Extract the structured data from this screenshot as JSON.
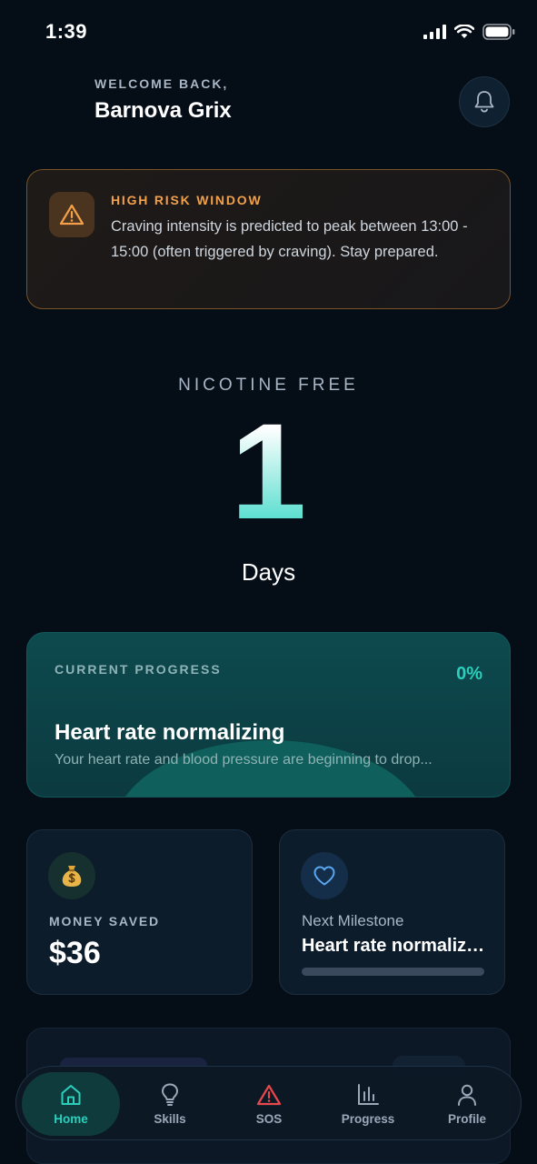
{
  "status_bar": {
    "time": "1:39"
  },
  "header": {
    "welcome": "WELCOME BACK,",
    "username": "Barnova Grix"
  },
  "risk_alert": {
    "title": "HIGH RISK WINDOW",
    "message": "Craving intensity is predicted to peak between 13:00 - 15:00 (often triggered by craving). Stay prepared.",
    "accent_color": "#f3a04a"
  },
  "streak": {
    "label": "NICOTINE FREE",
    "count": "1",
    "unit": "Days"
  },
  "current_progress": {
    "label": "CURRENT PROGRESS",
    "percent": "0%",
    "title": "Heart rate normalizing",
    "description": "Your heart rate and blood pressure are beginning to drop..."
  },
  "money": {
    "icon": "money-bag-icon",
    "label": "MONEY SAVED",
    "value": "$36"
  },
  "milestone": {
    "icon": "heart-icon",
    "label": "Next Milestone",
    "value": "Heart rate normalizing",
    "progress": 0
  },
  "tabs": [
    {
      "label": "Home",
      "icon": "home-icon",
      "active": true
    },
    {
      "label": "Skills",
      "icon": "lightbulb-icon"
    },
    {
      "label": "SOS",
      "icon": "warning-icon"
    },
    {
      "label": "Progress",
      "icon": "bar-chart-icon"
    },
    {
      "label": "Profile",
      "icon": "user-icon"
    }
  ],
  "colors": {
    "background": "#050d17",
    "accent": "#2bd0bc",
    "warning": "#f3a04a",
    "sos": "#e5484d"
  }
}
